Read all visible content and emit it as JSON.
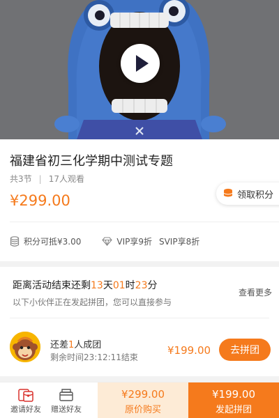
{
  "cover": {
    "play_icon": "play-icon",
    "mark": "close-icon"
  },
  "course": {
    "title": "福建省初三化学期中测试专题",
    "sections": "共3节",
    "views": "17人观看",
    "price": "¥299.00",
    "points_button": "领取积分",
    "points_offset": "积分可抵¥3.00",
    "vip": "VIP享9折",
    "svip": "SVIP享8折"
  },
  "activity": {
    "prefix": "距离活动结束还剩",
    "days": "13",
    "days_unit": "天",
    "hours": "01",
    "hours_unit": "时",
    "minutes": "23",
    "minutes_unit": "分",
    "more": "查看更多",
    "subtitle": "以下小伙伴正在发起拼团，您可以直接参与",
    "member": {
      "need_prefix": "还差",
      "need_count": "1",
      "need_suffix": "人成团",
      "remaining": "剩余时间23:12:11结束",
      "price": "¥199.00",
      "join": "去拼团"
    }
  },
  "bottom": {
    "invite": "邀请好友",
    "gift": "赠送好友",
    "orig_price": "¥299.00",
    "orig_label": "原价购买",
    "group_price": "¥199.00",
    "group_label": "发起拼团"
  },
  "colors": {
    "accent": "#f57a1c",
    "accent_light": "#fdebd6"
  }
}
